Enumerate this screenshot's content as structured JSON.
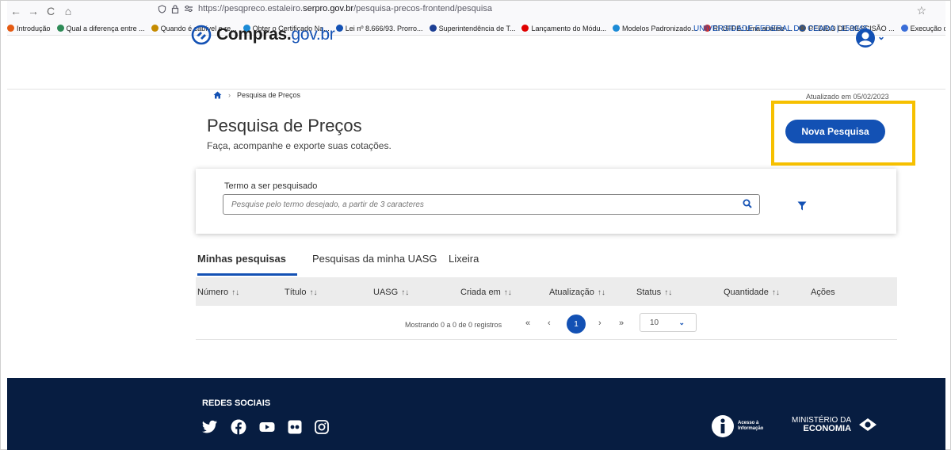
{
  "browser": {
    "back": "←",
    "forward": "→",
    "reload": "C",
    "home": "⌂",
    "url_prefix": "https://pesqpreco.estaleiro.",
    "url_host": "serpro.gov.br",
    "url_path": "/pesquisa-precos-frontend/pesquisa",
    "bookmarks": [
      {
        "label": "Introdução",
        "color": "#e55b13"
      },
      {
        "label": "Qual a diferença entre ...",
        "color": "#2e8b57"
      },
      {
        "label": "Quando é cabível o re...",
        "color": "#c58b00"
      },
      {
        "label": "Obter o Certificado Na...",
        "color": "#1c8bd6"
      },
      {
        "label": "Lei nº 8.666/93. Prorro...",
        "color": "#1351b4"
      },
      {
        "label": "Superintendência de T...",
        "color": "#1c3f94"
      },
      {
        "label": "Lançamento do Módu...",
        "color": "#e00000"
      },
      {
        "label": "Modelos Padronizado...",
        "color": "#1c8bd6"
      },
      {
        "label": "RI UFPE: Uma análise ...",
        "color": "#d03030"
      },
      {
        "label": "PEDIDO DE RESCISÃO ...",
        "color": "#555555"
      },
      {
        "label": "Execução do contrato",
        "color": "#3a6ed8"
      }
    ]
  },
  "header": {
    "logo_main": "Compras.",
    "logo_gov": "gov.br",
    "org": "UNIVERSIDADE FEDERAL DO CEARA | 153045"
  },
  "breadcrumb": {
    "current": "Pesquisa de Preços"
  },
  "updated": "Atualizado em 05/02/2023",
  "page": {
    "title": "Pesquisa de Preços",
    "subtitle": "Faça, acompanhe e exporte suas cotações.",
    "new_button": "Nova Pesquisa"
  },
  "search": {
    "label": "Termo a ser pesquisado",
    "placeholder": "Pesquise pelo termo desejado, a partir de 3 caracteres"
  },
  "tabs": [
    {
      "label": "Minhas pesquisas"
    },
    {
      "label": "Pesquisas da minha UASG"
    },
    {
      "label": "Lixeira"
    }
  ],
  "table": {
    "columns": [
      "Número",
      "Título",
      "UASG",
      "Criada em",
      "Atualização",
      "Status",
      "Quantidade",
      "Ações"
    ],
    "sort_glyph": "↑↓",
    "showing": "Mostrando 0 a 0 de 0 registros",
    "page_first": "«",
    "page_prev": "‹",
    "page_current": "1",
    "page_next": "›",
    "page_last": "»",
    "per_page": "10"
  },
  "footer": {
    "social_title": "REDES SOCIAIS",
    "acesso_line1": "Acesso à",
    "acesso_line2": "Informação",
    "min_line1": "MINISTÉRIO DA",
    "min_line2": "ECONOMIA"
  },
  "colors": {
    "primary": "#1351b4",
    "highlight": "#f6c000",
    "footer": "#071d41"
  }
}
